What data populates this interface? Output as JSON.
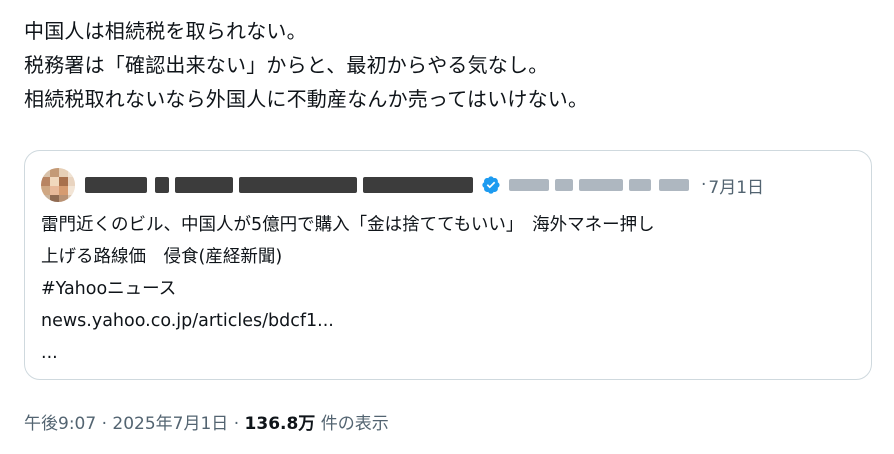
{
  "tweet": {
    "lines": [
      "中国人は相続税を取られない。",
      "税務署は「確認出来ない」からと、最初からやる気なし。",
      "相続税取れないなら外国人に不動産なんか売ってはいけない。"
    ]
  },
  "quote": {
    "separator": "·",
    "date": "7月1日",
    "body_lines": [
      "雷門近くのビル、中国人が5億円で購入「金は捨ててもいい」　海外マネー押し",
      "上げる路線価　侵食(産経新聞)",
      "#Yahooニュース",
      "news.yahoo.co.jp/articles/bdcf1...",
      "..."
    ],
    "verified_color": "#1d9bf0"
  },
  "meta": {
    "time": "午後9:07",
    "dot1": " · ",
    "date": "2025年7月1日",
    "dot2": " · ",
    "views": "136.8万",
    "views_label": " 件の表示"
  }
}
